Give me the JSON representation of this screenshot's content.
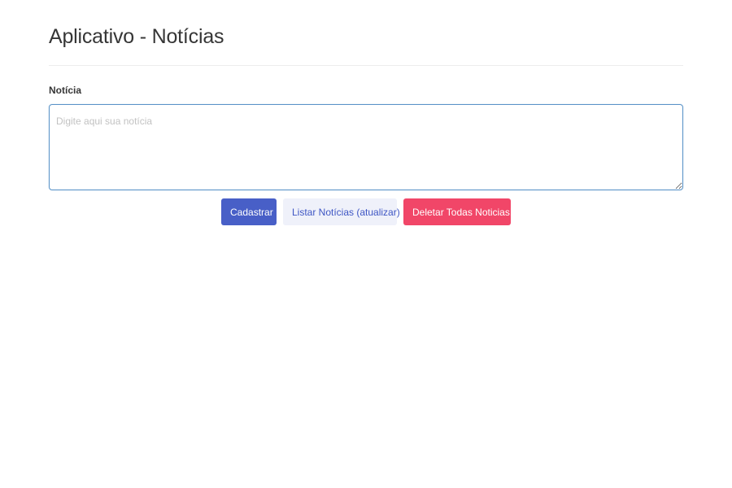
{
  "header": {
    "title": "Aplicativo - Notícias"
  },
  "form": {
    "label": "Notícia",
    "placeholder": "Digite aqui sua notícia",
    "value": ""
  },
  "actions": {
    "register_label": "Cadastrar",
    "list_label": "Listar Notícias (atualizar)",
    "delete_all_label": "Deletar Todas Noticias!"
  },
  "colors": {
    "primary": "#485fc7",
    "light": "#eff1fa",
    "danger": "#f14668",
    "focus_border": "#5a93c8"
  }
}
